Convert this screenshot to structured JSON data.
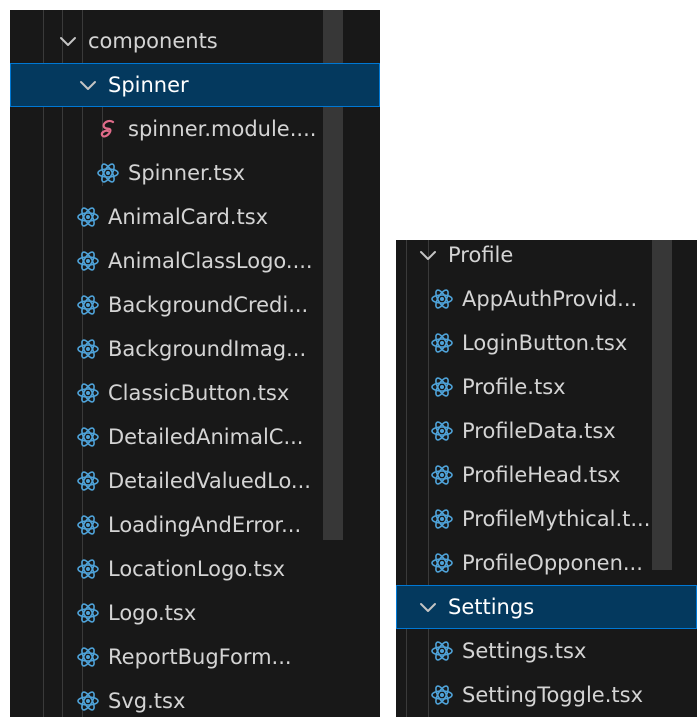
{
  "left_panel": {
    "rows": [
      {
        "label": "components",
        "icon": "chevron-down-icon",
        "kind": "folder",
        "depth": 2,
        "selected": false
      },
      {
        "label": "Spinner",
        "icon": "chevron-down-icon",
        "kind": "folder",
        "depth": 3,
        "selected": true
      },
      {
        "label": "spinner.module....",
        "icon": "sass-file-icon",
        "kind": "file",
        "depth": 4,
        "selected": false
      },
      {
        "label": "Spinner.tsx",
        "icon": "react-icon",
        "kind": "file",
        "depth": 4,
        "selected": false
      },
      {
        "label": "AnimalCard.tsx",
        "icon": "react-icon",
        "kind": "file",
        "depth": 3,
        "selected": false
      },
      {
        "label": "AnimalClassLogo....",
        "icon": "react-icon",
        "kind": "file",
        "depth": 3,
        "selected": false
      },
      {
        "label": "BackgroundCredi...",
        "icon": "react-icon",
        "kind": "file",
        "depth": 3,
        "selected": false
      },
      {
        "label": "BackgroundImag...",
        "icon": "react-icon",
        "kind": "file",
        "depth": 3,
        "selected": false
      },
      {
        "label": "ClassicButton.tsx",
        "icon": "react-icon",
        "kind": "file",
        "depth": 3,
        "selected": false
      },
      {
        "label": "DetailedAnimalC...",
        "icon": "react-icon",
        "kind": "file",
        "depth": 3,
        "selected": false
      },
      {
        "label": "DetailedValuedLo...",
        "icon": "react-icon",
        "kind": "file",
        "depth": 3,
        "selected": false
      },
      {
        "label": "LoadingAndError...",
        "icon": "react-icon",
        "kind": "file",
        "depth": 3,
        "selected": false
      },
      {
        "label": "LocationLogo.tsx",
        "icon": "react-icon",
        "kind": "file",
        "depth": 3,
        "selected": false
      },
      {
        "label": "Logo.tsx",
        "icon": "react-icon",
        "kind": "file",
        "depth": 3,
        "selected": false
      },
      {
        "label": "ReportBugForm...",
        "icon": "react-icon",
        "kind": "file",
        "depth": 3,
        "selected": false
      },
      {
        "label": "Svg.tsx",
        "icon": "react-icon",
        "kind": "file",
        "depth": 3,
        "selected": false
      }
    ]
  },
  "right_panel": {
    "rows": [
      {
        "label": "Profile",
        "icon": "chevron-down-icon",
        "kind": "folder",
        "depth": 0,
        "selected": false
      },
      {
        "label": "AppAuthProvid...",
        "icon": "react-icon",
        "kind": "file",
        "depth": 1,
        "selected": false
      },
      {
        "label": "LoginButton.tsx",
        "icon": "react-icon",
        "kind": "file",
        "depth": 1,
        "selected": false
      },
      {
        "label": "Profile.tsx",
        "icon": "react-icon",
        "kind": "file",
        "depth": 1,
        "selected": false
      },
      {
        "label": "ProfileData.tsx",
        "icon": "react-icon",
        "kind": "file",
        "depth": 1,
        "selected": false
      },
      {
        "label": "ProfileHead.tsx",
        "icon": "react-icon",
        "kind": "file",
        "depth": 1,
        "selected": false
      },
      {
        "label": "ProfileMythical.t...",
        "icon": "react-icon",
        "kind": "file",
        "depth": 1,
        "selected": false
      },
      {
        "label": "ProfileOpponen...",
        "icon": "react-icon",
        "kind": "file",
        "depth": 1,
        "selected": false
      },
      {
        "label": "Settings",
        "icon": "chevron-down-icon",
        "kind": "folder",
        "depth": 0,
        "selected": true
      },
      {
        "label": "Settings.tsx",
        "icon": "react-icon",
        "kind": "file",
        "depth": 1,
        "selected": false
      },
      {
        "label": "SettingToggle.tsx",
        "icon": "react-icon",
        "kind": "file",
        "depth": 1,
        "selected": false
      }
    ]
  },
  "colors": {
    "panel_background": "#181818",
    "text": "#d4d4d4",
    "selected_background": "#04395e",
    "selected_border": "#0078d4",
    "react_icon": "#4fa3d9",
    "sass_icon": "#e06c8a",
    "chevron": "#c5c5c5"
  }
}
